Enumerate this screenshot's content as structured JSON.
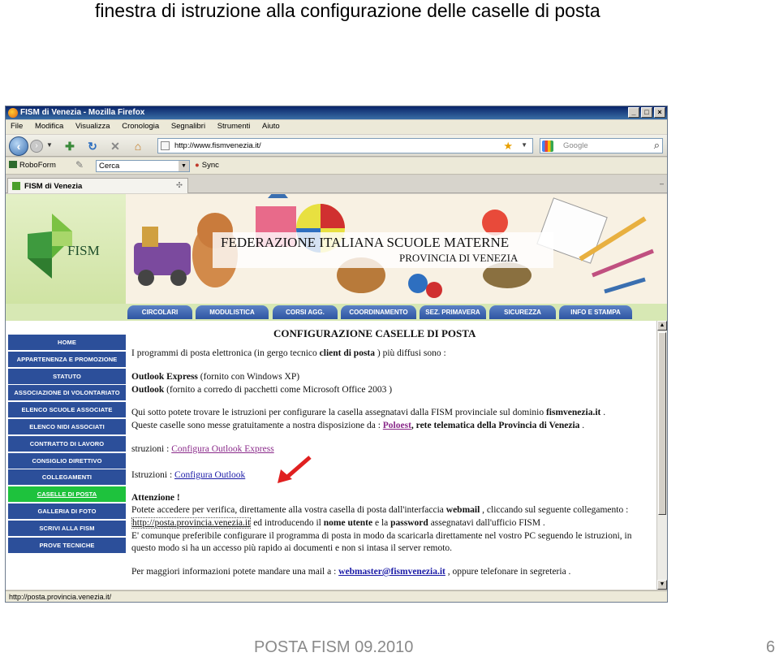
{
  "slide": {
    "title": "finestra di istruzione alla configurazione delle caselle di posta",
    "footer": "POSTA FISM 09.2010",
    "page_number": "6"
  },
  "browser": {
    "window_title": "FISM di Venezia - Mozilla Firefox",
    "menu": [
      "File",
      "Modifica",
      "Visualizza",
      "Cronologia",
      "Segnalibri",
      "Strumenti",
      "Aiuto"
    ],
    "url": "http://www.fismvenezia.it/",
    "search_placeholder": "Google",
    "roboform_label": "RoboForm",
    "cerca_value": "Cerca",
    "sync_label": "Sync",
    "tab_label": "FISM di Venezia",
    "status_text": "http://posta.provincia.venezia.it/"
  },
  "site": {
    "logo_text": "FISM",
    "header_line1": "FEDERAZIONE ITALIANA SCUOLE MATERNE",
    "header_line2": "PROVINCIA DI VENEZIA",
    "top_nav": [
      "CIRCOLARI",
      "MODULISTICA",
      "CORSI AGG.",
      "COORDINAMENTO",
      "SEZ. PRIMAVERA",
      "SICUREZZA",
      "INFO E STAMPA"
    ],
    "sidebar": [
      "HOME",
      "APPARTENENZA E PROMOZIONE",
      "STATUTO",
      "ASSOCIAZIONE DI VOLONTARIATO",
      "ELENCO SCUOLE ASSOCIATE",
      "ELENCO NIDI ASSOCIATI",
      "CONTRATTO DI LAVORO",
      "CONSIGLIO DIRETTIVO",
      "COLLEGAMENTI",
      "CASELLE DI POSTA",
      "GALLERIA DI FOTO",
      "SCRIVI ALLA FISM",
      "PROVE TECNICHE"
    ],
    "active_sidebar_item": "CASELLE DI POSTA"
  },
  "content": {
    "heading": "CONFIGURAZIONE CASELLE DI POSTA",
    "p1_a": "I programmi di posta elettronica (in gergo tecnico ",
    "p1_b": "client di posta",
    "p1_c": " ) più diffusi sono :",
    "oe_name": "Outlook Express",
    "oe_desc": " (fornito con Windows XP)",
    "ol_name": "Outlook",
    "ol_desc": " (fornito a corredo di pacchetti come Microsoft Office 2003 )",
    "p2_a": "Qui sotto potete trovare le istruzioni per configurare la casella assegnatavi dalla FISM provinciale sul dominio ",
    "p2_domain": "fismvenezia.it",
    "p2_end": " .",
    "p3_a": "Queste caselle sono messe gratuitamente a nostra disposizione da : ",
    "p3_link": "Poloest",
    "p3_b": ", rete telematica della Provincia di Venezia",
    "p3_end": " .",
    "istr1_label": "struzioni : ",
    "istr1_link": "Configura Outlook Express",
    "istr2_label": "Istruzioni : ",
    "istr2_link": "Configura Outlook",
    "attention": "Attenzione !",
    "p4": "Potete accedere per verifica, direttamente alla vostra casella di posta dall'interfaccia ",
    "p4_bold": "webmail",
    "p4_end": " , cliccando sul seguente collegamento :",
    "webmail_link": "http://posta.provincia.venezia.it",
    "p5_a": " ed introducendo il ",
    "p5_b": "nome utente",
    "p5_c": " e la ",
    "p5_d": "password",
    "p5_e": " assegnatavi dall'ufficio FISM .",
    "p6": "E' comunque preferibile configurare il programma di posta in modo da scaricarla direttamente nel vostro PC seguendo le istruzioni, in",
    "p7": "questo modo si ha un accesso più rapido ai documenti e non si intasa il server remoto.",
    "p8_a": "Per maggiori informazioni potete mandare una mail a : ",
    "p8_link": "webmaster@fismvenezia.it",
    "p8_b": " , oppure telefonare in segreteria ."
  },
  "colors": {
    "sidebar_bg": "#2c4f9a",
    "sidebar_active": "#1ec23d",
    "annotation_arrow": "#e02020"
  }
}
